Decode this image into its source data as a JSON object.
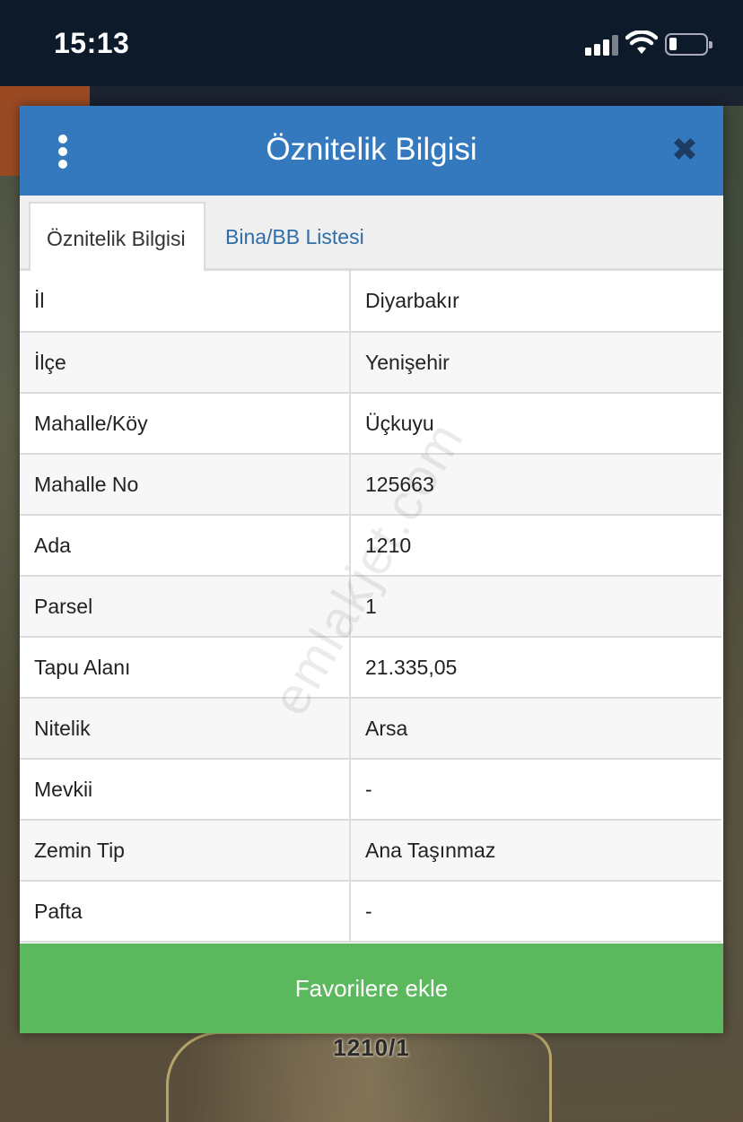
{
  "status_bar": {
    "time": "15:13"
  },
  "dialog": {
    "title": "Öznitelik Bilgisi",
    "close_glyph": "✖",
    "tabs": [
      {
        "label": "Öznitelik Bilgisi",
        "active": true
      },
      {
        "label": "Bina/BB Listesi",
        "active": false
      }
    ],
    "rows": [
      {
        "key": "İl",
        "value": "Diyarbakır"
      },
      {
        "key": "İlçe",
        "value": "Yenişehir"
      },
      {
        "key": "Mahalle/Köy",
        "value": "Üçkuyu"
      },
      {
        "key": "Mahalle No",
        "value": "125663"
      },
      {
        "key": "Ada",
        "value": "1210"
      },
      {
        "key": "Parsel",
        "value": "1"
      },
      {
        "key": "Tapu Alanı",
        "value": "21.335,05"
      },
      {
        "key": "Nitelik",
        "value": "Arsa"
      },
      {
        "key": "Mevkii",
        "value": "-"
      },
      {
        "key": "Zemin Tip",
        "value": "Ana Taşınmaz"
      },
      {
        "key": "Pafta",
        "value": "-"
      }
    ],
    "favorite_button": "Favorilere ekle"
  },
  "map": {
    "parcel_label": "1210/1"
  },
  "watermark": "emlakjet.com",
  "colors": {
    "header": "#3479bd",
    "tab_link": "#2f6ea8",
    "button": "#5cb85c",
    "status_bar": "#0c1a2a"
  }
}
